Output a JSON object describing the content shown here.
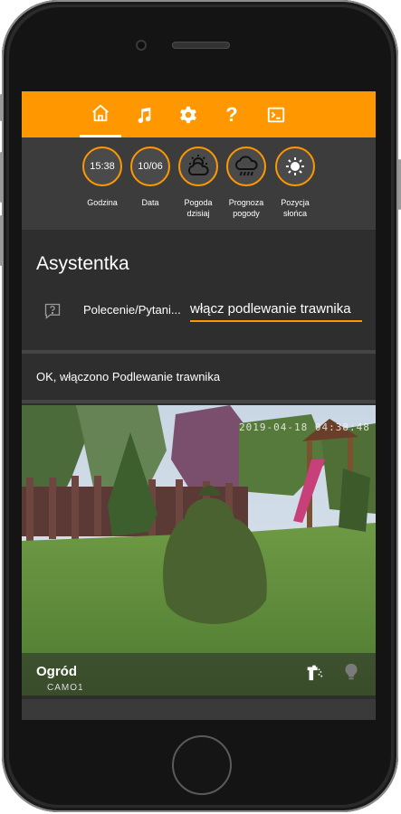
{
  "nav": {
    "items": [
      {
        "name": "home-icon",
        "active": true
      },
      {
        "name": "music-icon",
        "active": false
      },
      {
        "name": "gear-icon",
        "active": false
      },
      {
        "name": "help-icon",
        "active": false
      },
      {
        "name": "terminal-icon",
        "active": false
      }
    ],
    "help_glyph": "?"
  },
  "weather": {
    "items": [
      {
        "value": "15:38",
        "label": "Godzina"
      },
      {
        "value": "10/06",
        "label": "Data"
      },
      {
        "icon": "cloud-sun-icon",
        "label_line1": "Pogoda",
        "label_line2": "dzisiaj"
      },
      {
        "icon": "cloud-rain-icon",
        "label_line1": "Prognoza",
        "label_line2": "pogody"
      },
      {
        "icon": "sun-icon",
        "label_line1": "Pozycja",
        "label_line2": "słońca"
      }
    ]
  },
  "assistant": {
    "title": "Asystentka",
    "command_label": "Polecenie/Pytani...",
    "command_value": "włącz podlewanie trawnika"
  },
  "response": {
    "text": "OK, włączono Podlewanie trawnika"
  },
  "camera": {
    "name": "Ogród",
    "id": "CAMO1",
    "timestamp": "2019-04-18 04:38:48"
  },
  "colors": {
    "accent": "#ff9800",
    "panel": "#2e2e2e",
    "weather_bg": "#3c3c3c"
  }
}
